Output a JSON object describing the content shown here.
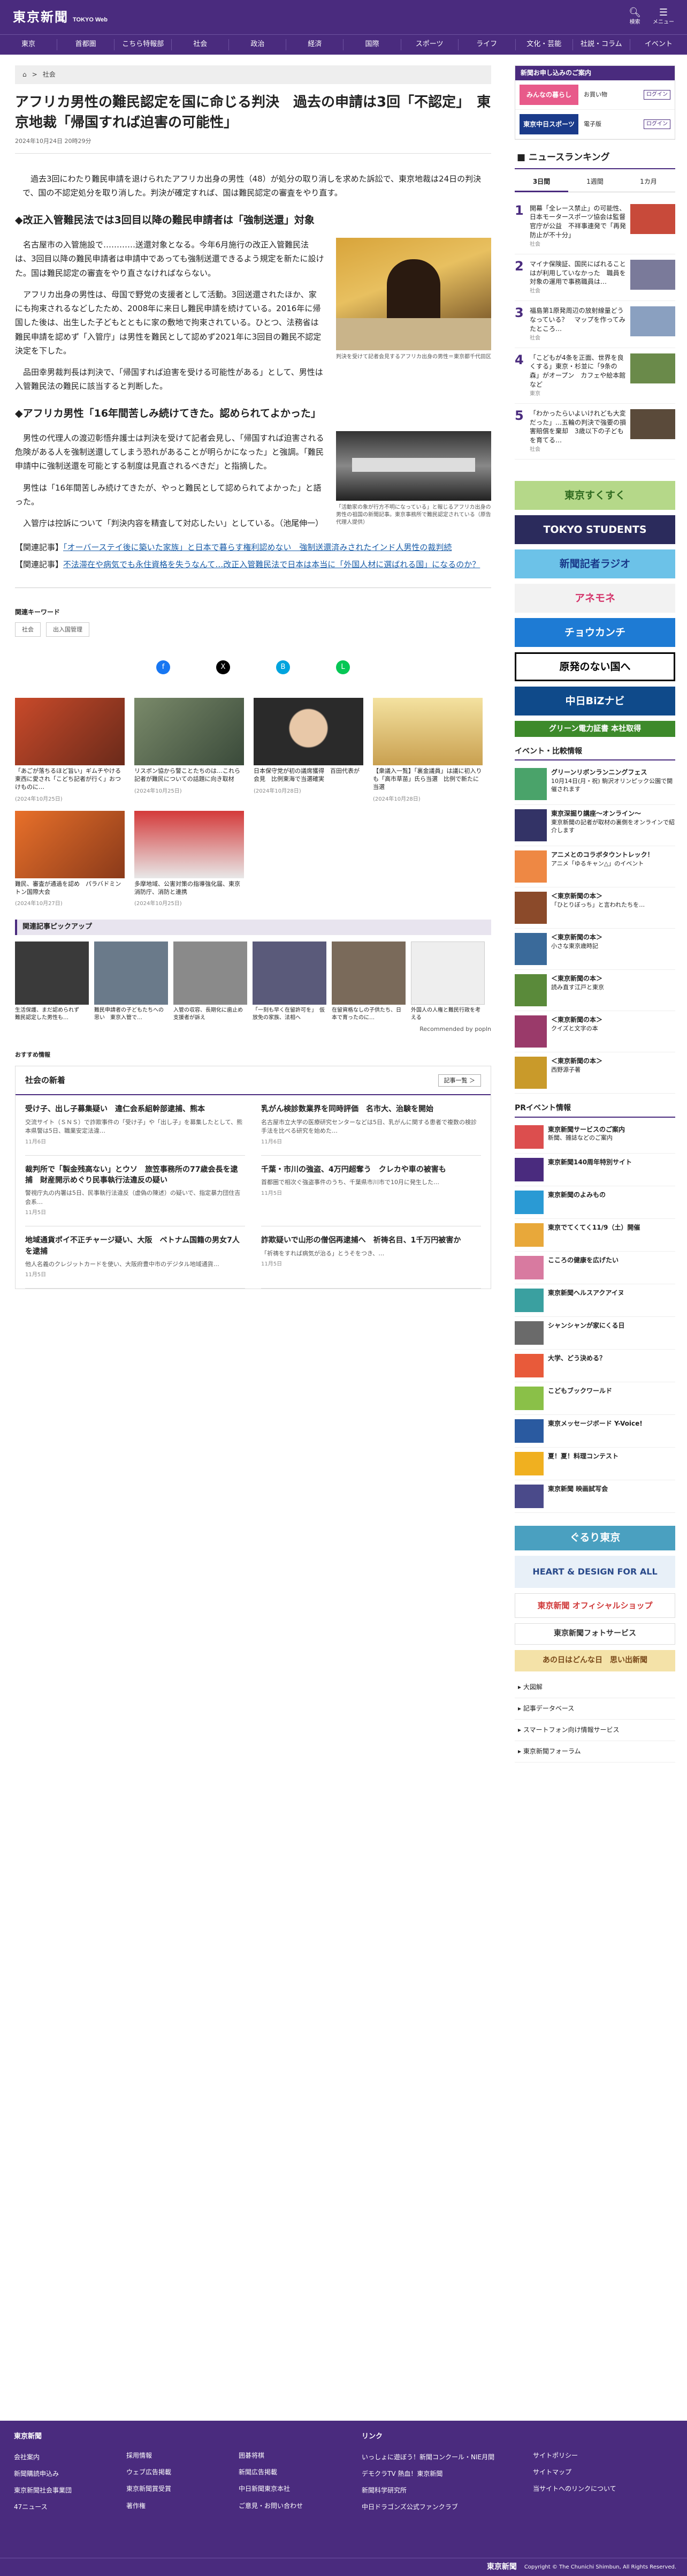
{
  "header": {
    "logo": "東京新聞",
    "logo_sub": "TOKYO Web",
    "icons": [
      {
        "icon": "search-icon",
        "label": "検索"
      },
      {
        "icon": "menu-icon",
        "label": "メニュー"
      }
    ]
  },
  "nav": [
    "東京",
    "首都圏",
    "こちら特報部",
    "社会",
    "政治",
    "経済",
    "国際",
    "スポーツ",
    "ライフ",
    "文化・芸能",
    "社説・コラム",
    "イベント"
  ],
  "breadcrumb": {
    "home": "ホーム",
    "category": "社会"
  },
  "article": {
    "title": "アフリカ男性の難民認定を国に命じる判決　過去の申請は3回「不認定」　東京地裁「帰国すれば迫害の可能性」",
    "date": "2024年10月24日 20時29分",
    "lead": "　過去3回にわたり難民申請を退けられたアフリカ出身の男性（48）が処分の取り消しを求めた訴訟で、東京地裁は24日の判決で、国の不認定処分を取り消した。判決が確定すれば、国は難民認定の審査をやり直す。",
    "h2_1": "◆改正入管難民法では3回目以降の難民申請者は「強制送還」対象",
    "p1": "　名古屋市の入管施設で…………送還対象となる。今年6月施行の改正入管難民法は、3回目以降の難民申請者は申請中であっても強制送還できるよう規定を新たに設けた。国は難民認定の審査をやり直さなければならない。",
    "p2": "　アフリカ出身の男性は、母国で野党の支援者として活動。3回送還されたほか、家にも拘束されるなどしたため、2008年に来日し難民申請を続けている。2016年に帰国した後は、出生した子どもとともに家の敷地で拘束されている。ひとつ、法務省は難民申請を認めず「入管庁」は男性を難民として認めず2021年に3回目の難民不認定決定を下した。",
    "p3": "　品田幸男裁判長は判決で、「帰国すれば迫害を受ける可能性がある」として、男性は入管難民法の難民に該当すると判断した。",
    "h2_2": "◆アフリカ男性「16年間苦しみ続けてきた。認められてよかった」",
    "p4": "　男性の代理人の渡辺彰悟弁護士は判決を受けて記者会見し、「帰国すれば迫害される危険がある人を強制送還してしまう恐れがあることが明らかになった」と強調。「難民申請中に強制送還を可能とする制度は見直されるべきだ」と指摘した。",
    "p5": "　男性は「16年間苦しみ続けてきたが、やっと難民として認められてよかった」と語った。",
    "p6": "　入管庁は控訴について「判決内容を精査して対応したい」としている。（池尾伸一）",
    "caption1": "判決を受けて記者会見するアフリカ出身の男性＝東京都千代田区",
    "caption2": "「活動家の象が行方不明になっている」と報じるアフリカ出身の男性の祖国の新聞記事。東京事務所で難民認定されている（原告代理人提供）",
    "related": [
      {
        "prefix": "【関連記事】",
        "text": "「オーバーステイ後に築いた家族」と日本で暮らす権利認めない　強制送還済みされたインド人男性の裁判続"
      },
      {
        "prefix": "【関連記事】",
        "text": "不法滞在や病気でも永住資格を失うなんて…改正入管難民法で日本は本当に「外国人材に選ばれる国」になるのか？"
      }
    ]
  },
  "keywords": {
    "title": "関連キーワード",
    "tags": [
      "社会",
      "出入国管理"
    ]
  },
  "share_icons": [
    "facebook-icon",
    "x-icon",
    "hatena-icon",
    "line-icon"
  ],
  "thumbs": [
    {
      "text": "「あごが落ちるほど旨い」ギムチやける東西に愛され「こどち記者が行く」おつけものに…",
      "date": "(2024年10月25日)"
    },
    {
      "text": "リスボン協から警ことたちのは…これら記者が難民についての話題に向き取材",
      "date": "(2024年10月25日)"
    },
    {
      "text": "日本保守党が初の議席獲得　百田代表が会見　比例東海で当選確実",
      "date": "(2024年10月28日)"
    },
    {
      "text": "【衆議入一覧】「裏金議員」は議に初入りも「高市草苗」氏ら当選　比例で新たに当選",
      "date": "(2024年10月28日)"
    },
    {
      "text": "難民、審査が通過を認め　パラバドミントン国際大会",
      "date": "(2024年10月27日)"
    },
    {
      "text": "多摩地域、公害対策の指導強化届、東京消防庁、消防と連携",
      "date": "(2024年10月25日)"
    }
  ],
  "pickup": {
    "title": "関連記事ピックアップ",
    "items": [
      "生活保護、まだ認められず　難民認定した男性も…",
      "難民申請者の子どもたちへの思い　東京入管で…",
      "入管の収容、長期化に歯止め　支援者が訴え",
      "「一刻も早く在留許可を」　仮放免の家族、法相へ",
      "在留資格なしの子供たち、日本で育ったのに…",
      "外国人の人権と難民行政を考える"
    ],
    "recommended": "Recommended by  popln"
  },
  "recommend_title": "おすすめ情報",
  "social_news": {
    "title": "社会の新着",
    "more": "記事一覧 ＞",
    "items": [
      {
        "title": "受け子、出し子募集疑い　違仁会系組幹部逮捕、熊本",
        "desc": "交流サイト（ＳＮＳ）で詐欺事件の「受け子」や「出し子」を募集したとして、熊本県警は5日、職業安定法違…",
        "date": "11月6日"
      },
      {
        "title": "乳がん検診数業界を同時評価　名市大、治験を開始",
        "desc": "名古屋市立大学の医療研究センターなどは5日、乳がんに関する患者で複数の検診手法を比べる研究を始めた…",
        "date": "11月6日"
      },
      {
        "title": "裁判所で「製金残高ない」とウソ　旅笠事務所の77歳会長を逮捕　財産開示めぐり民事執行法違反の疑い",
        "desc": "警視庁丸の内署は5日、民事執行法違反（虚偽の陳述）の疑いで、指定暴力団住吉会系…",
        "date": "11月5日"
      },
      {
        "title": "千葉・市川の強盗、4万円超奪う　クレカや車の被害も",
        "desc": "首都圏で相次ぐ強盗事件のうち、千葉県市川市で10月に発生した…",
        "date": "11月5日"
      },
      {
        "title": "地域通貨ポイ不正チャージ疑い、大阪　ペトナム国籍の男女7人を逮捕",
        "desc": "他人名義のクレジットカードを使い、大阪府豊中市のデジタル地域通貨…",
        "date": "11月5日"
      },
      {
        "title": "詐欺疑いで山形の僧侶再逮捕へ　祈祷名目、1千万円被害か",
        "desc": "「祈祷をすれば病気が治る」とうそをつき、…",
        "date": "11月5日"
      }
    ]
  },
  "sidebar": {
    "promo_title": "新聞お申し込みのご案内",
    "promos": [
      {
        "name": "みんなの暮らし",
        "sub": "お買い物",
        "btn": "ログイン"
      },
      {
        "name": "東京中日スポーツ",
        "sub": "電子版",
        "btn": "ログイン"
      }
    ],
    "ranking_title": "ニュースランキング",
    "ranking_tabs": [
      "3日間",
      "1週間",
      "1カ月"
    ],
    "ranking": [
      {
        "n": "1",
        "text": "開幕「全レース禁止」の可能性、日本モータースポーツ協会は監督官庁が公益　不祥事連発で「再発防止が不十分」",
        "cat": "社会"
      },
      {
        "n": "2",
        "text": "マイナ保険証、国民にばれることはが利用していなかった　職員を対象の運用で事務職員は…",
        "cat": "社会"
      },
      {
        "n": "3",
        "text": "福島第1原発周辺の放射線量どうなっている？　マップを作ってみたところ…",
        "cat": "社会"
      },
      {
        "n": "4",
        "text": "「こどもが4条を正面、世界を良くする」東京・杉並に「9条の森」がオープン　カフェや絵本館など",
        "cat": "東京"
      },
      {
        "n": "5",
        "text": "「わかったらいよいけれども大変だった」…五輪の判決で強要の損害賠償を棄却　3歳以下の子どもを育てる…",
        "cat": "社会"
      }
    ],
    "banners": [
      {
        "text": "東京すくすく",
        "bg": "#b5d889",
        "fg": "#2f6a1f"
      },
      {
        "text": "TOKYO STUDENTS",
        "bg": "#2b2b5c",
        "fg": "#ffffff"
      },
      {
        "text": "新聞記者ラジオ",
        "bg": "#6cc2e8",
        "fg": "#1a3a8a"
      },
      {
        "text": "アネモネ",
        "bg": "#f2f2f2",
        "fg": "#d4336a"
      },
      {
        "text": "チョウカンチ",
        "bg": "#1e7bd4",
        "fg": "#ffffff"
      },
      {
        "text": "原発のない国へ",
        "bg": "#ffffff",
        "fg": "#000000"
      },
      {
        "text": "中日BiZナビ",
        "bg": "#0f4a8a",
        "fg": "#ffffff"
      },
      {
        "text": "グリーン電力証書 本社取得",
        "bg": "#3d8a2b",
        "fg": "#ffffff"
      }
    ],
    "events_title": "イベント・比較情報",
    "events": [
      {
        "title": "グリーンリボンランニングフェス",
        "desc": "10月14日(月・祝) 駒沢オリンピック公園で開催されます",
        "color": "#4aa36a"
      },
      {
        "title": "東京深掘り講座〜オンライン〜",
        "desc": "東京新聞の記者が取材の裏側をオンラインで紹介します",
        "color": "#333366"
      },
      {
        "title": "アニメとのコラボタウントレック！",
        "desc": "アニメ「ゆるキャン△」のイベント",
        "color": "#ee8844"
      },
      {
        "title": "＜東京新聞の本＞",
        "desc": "「ひとりぼっち」と言われたちを…",
        "color": "#8b4a2a"
      },
      {
        "title": "＜東京新聞の本＞",
        "desc": "小さな東京歳時記",
        "color": "#3a6a9a"
      },
      {
        "title": "＜東京新聞の本＞",
        "desc": "読み直す江戸と東京",
        "color": "#5a8a3a"
      },
      {
        "title": "＜東京新聞の本＞",
        "desc": "クイズと文字の本",
        "color": "#9a3a6a"
      },
      {
        "title": "＜東京新聞の本＞",
        "desc": "西野源子著",
        "color": "#c99a2a"
      }
    ],
    "pr_title": "PRイベント情報",
    "pr": [
      {
        "title": "東京新聞サービスのご案内",
        "desc": "新聞、雑誌などのご案内",
        "color": "#dc4e4e"
      },
      {
        "title": "東京新聞140周年特別サイト",
        "desc": "",
        "color": "#4a2b7e"
      },
      {
        "title": "東京新聞のよみもの",
        "desc": "",
        "color": "#2a9ad4"
      },
      {
        "title": "東京でてくてく11/9（土）開催",
        "desc": "",
        "color": "#e8a83a"
      },
      {
        "title": "こころの健康を広げたい",
        "desc": "",
        "color": "#d87aa0"
      },
      {
        "title": "東京新聞ヘルスアクアイヌ",
        "desc": "",
        "color": "#3aa0a0"
      },
      {
        "title": "シャンシャンが家にくる日",
        "desc": "",
        "color": "#6a6a6a"
      },
      {
        "title": "大学、どう決める？",
        "desc": "",
        "color": "#e85a3a"
      },
      {
        "title": "こどもブックワールド",
        "desc": "",
        "color": "#8ac048"
      },
      {
        "title": "東京メッセージボード Y-Voice!",
        "desc": "",
        "color": "#2a5aa0"
      },
      {
        "title": "夏！夏！料理コンテスト",
        "desc": "",
        "color": "#f0b020"
      },
      {
        "title": "東京新聞 映画試写会",
        "desc": "",
        "color": "#4a4a8a"
      }
    ],
    "bottom_banners": [
      {
        "text": "ぐるり東京",
        "bg": "#4aa0c0",
        "fg": "#ffffff"
      },
      {
        "text": "HEART & DESIGN FOR ALL",
        "bg": "#e8f0f8",
        "fg": "#2a4a8a"
      },
      {
        "text": "東京新聞 オフィシャルショップ",
        "bg": "#ffffff",
        "fg": "#d03a3a"
      },
      {
        "text": "東京新聞フォトサービス",
        "bg": "#ffffff",
        "fg": "#333333"
      },
      {
        "text": "あの日はどんな日　思い出新聞",
        "bg": "#f4e2a8",
        "fg": "#7a4a1a"
      }
    ],
    "links": [
      "大図解",
      "記事データベース",
      "スマートフォン向け情報サービス",
      "東京新聞フォーラム"
    ]
  },
  "footer": {
    "brand": "東京新聞",
    "col1": [
      "会社案内",
      "新聞購読申込み",
      "東京新聞社会事業団",
      "47ニュース"
    ],
    "col2": [
      "採用情報",
      "ウェブ広告掲載",
      "東京新聞賞受賞",
      "著作権"
    ],
    "col3": [
      "囲碁将棋",
      "新聞広告掲載",
      "中日新聞東京本社",
      "ご意見・お問い合わせ"
    ],
    "links_title": "リンク",
    "col4": [
      "いっしょに遊ぼう！新聞コンクール・NIE月間",
      "デモクラTV 熱血！東京新聞",
      "新聞科学研究所",
      "中日ドラゴンズ公式ファンクラブ"
    ],
    "col5": [
      "サイトポリシー",
      "サイトマップ",
      "当サイトへのリンクについて"
    ],
    "copyright": "Copyright © The Chunichi Shimbun, All Rights Reserved."
  }
}
